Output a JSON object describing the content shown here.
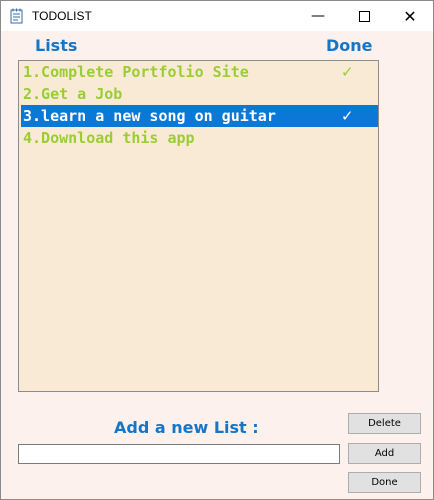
{
  "window": {
    "title": "TODOLIST"
  },
  "headers": {
    "lists": "Lists",
    "done": "Done"
  },
  "tasks": [
    {
      "text": "1.Complete Portfolio Site",
      "done_mark": "✓",
      "selected": false
    },
    {
      "text": "2.Get a Job",
      "done_mark": "",
      "selected": false
    },
    {
      "text": "3.learn a new song on guitar",
      "done_mark": "✓",
      "selected": true
    },
    {
      "text": "4.Download this app",
      "done_mark": "",
      "selected": false
    }
  ],
  "add_section": {
    "label": "Add a new List :",
    "input_value": ""
  },
  "buttons": {
    "delete": "Delete",
    "add": "Add",
    "done": "Done"
  },
  "colors": {
    "header": "#1576c8",
    "task_text": "#9acd32",
    "selection": "#0a78d7",
    "list_bg": "#f9ead5",
    "window_bg": "#fdf1ee"
  },
  "icons": {
    "app": "notepad-icon",
    "minimize": "minimize-icon",
    "maximize": "maximize-icon",
    "close": "close-icon",
    "done_mark": "checkmark-icon"
  }
}
